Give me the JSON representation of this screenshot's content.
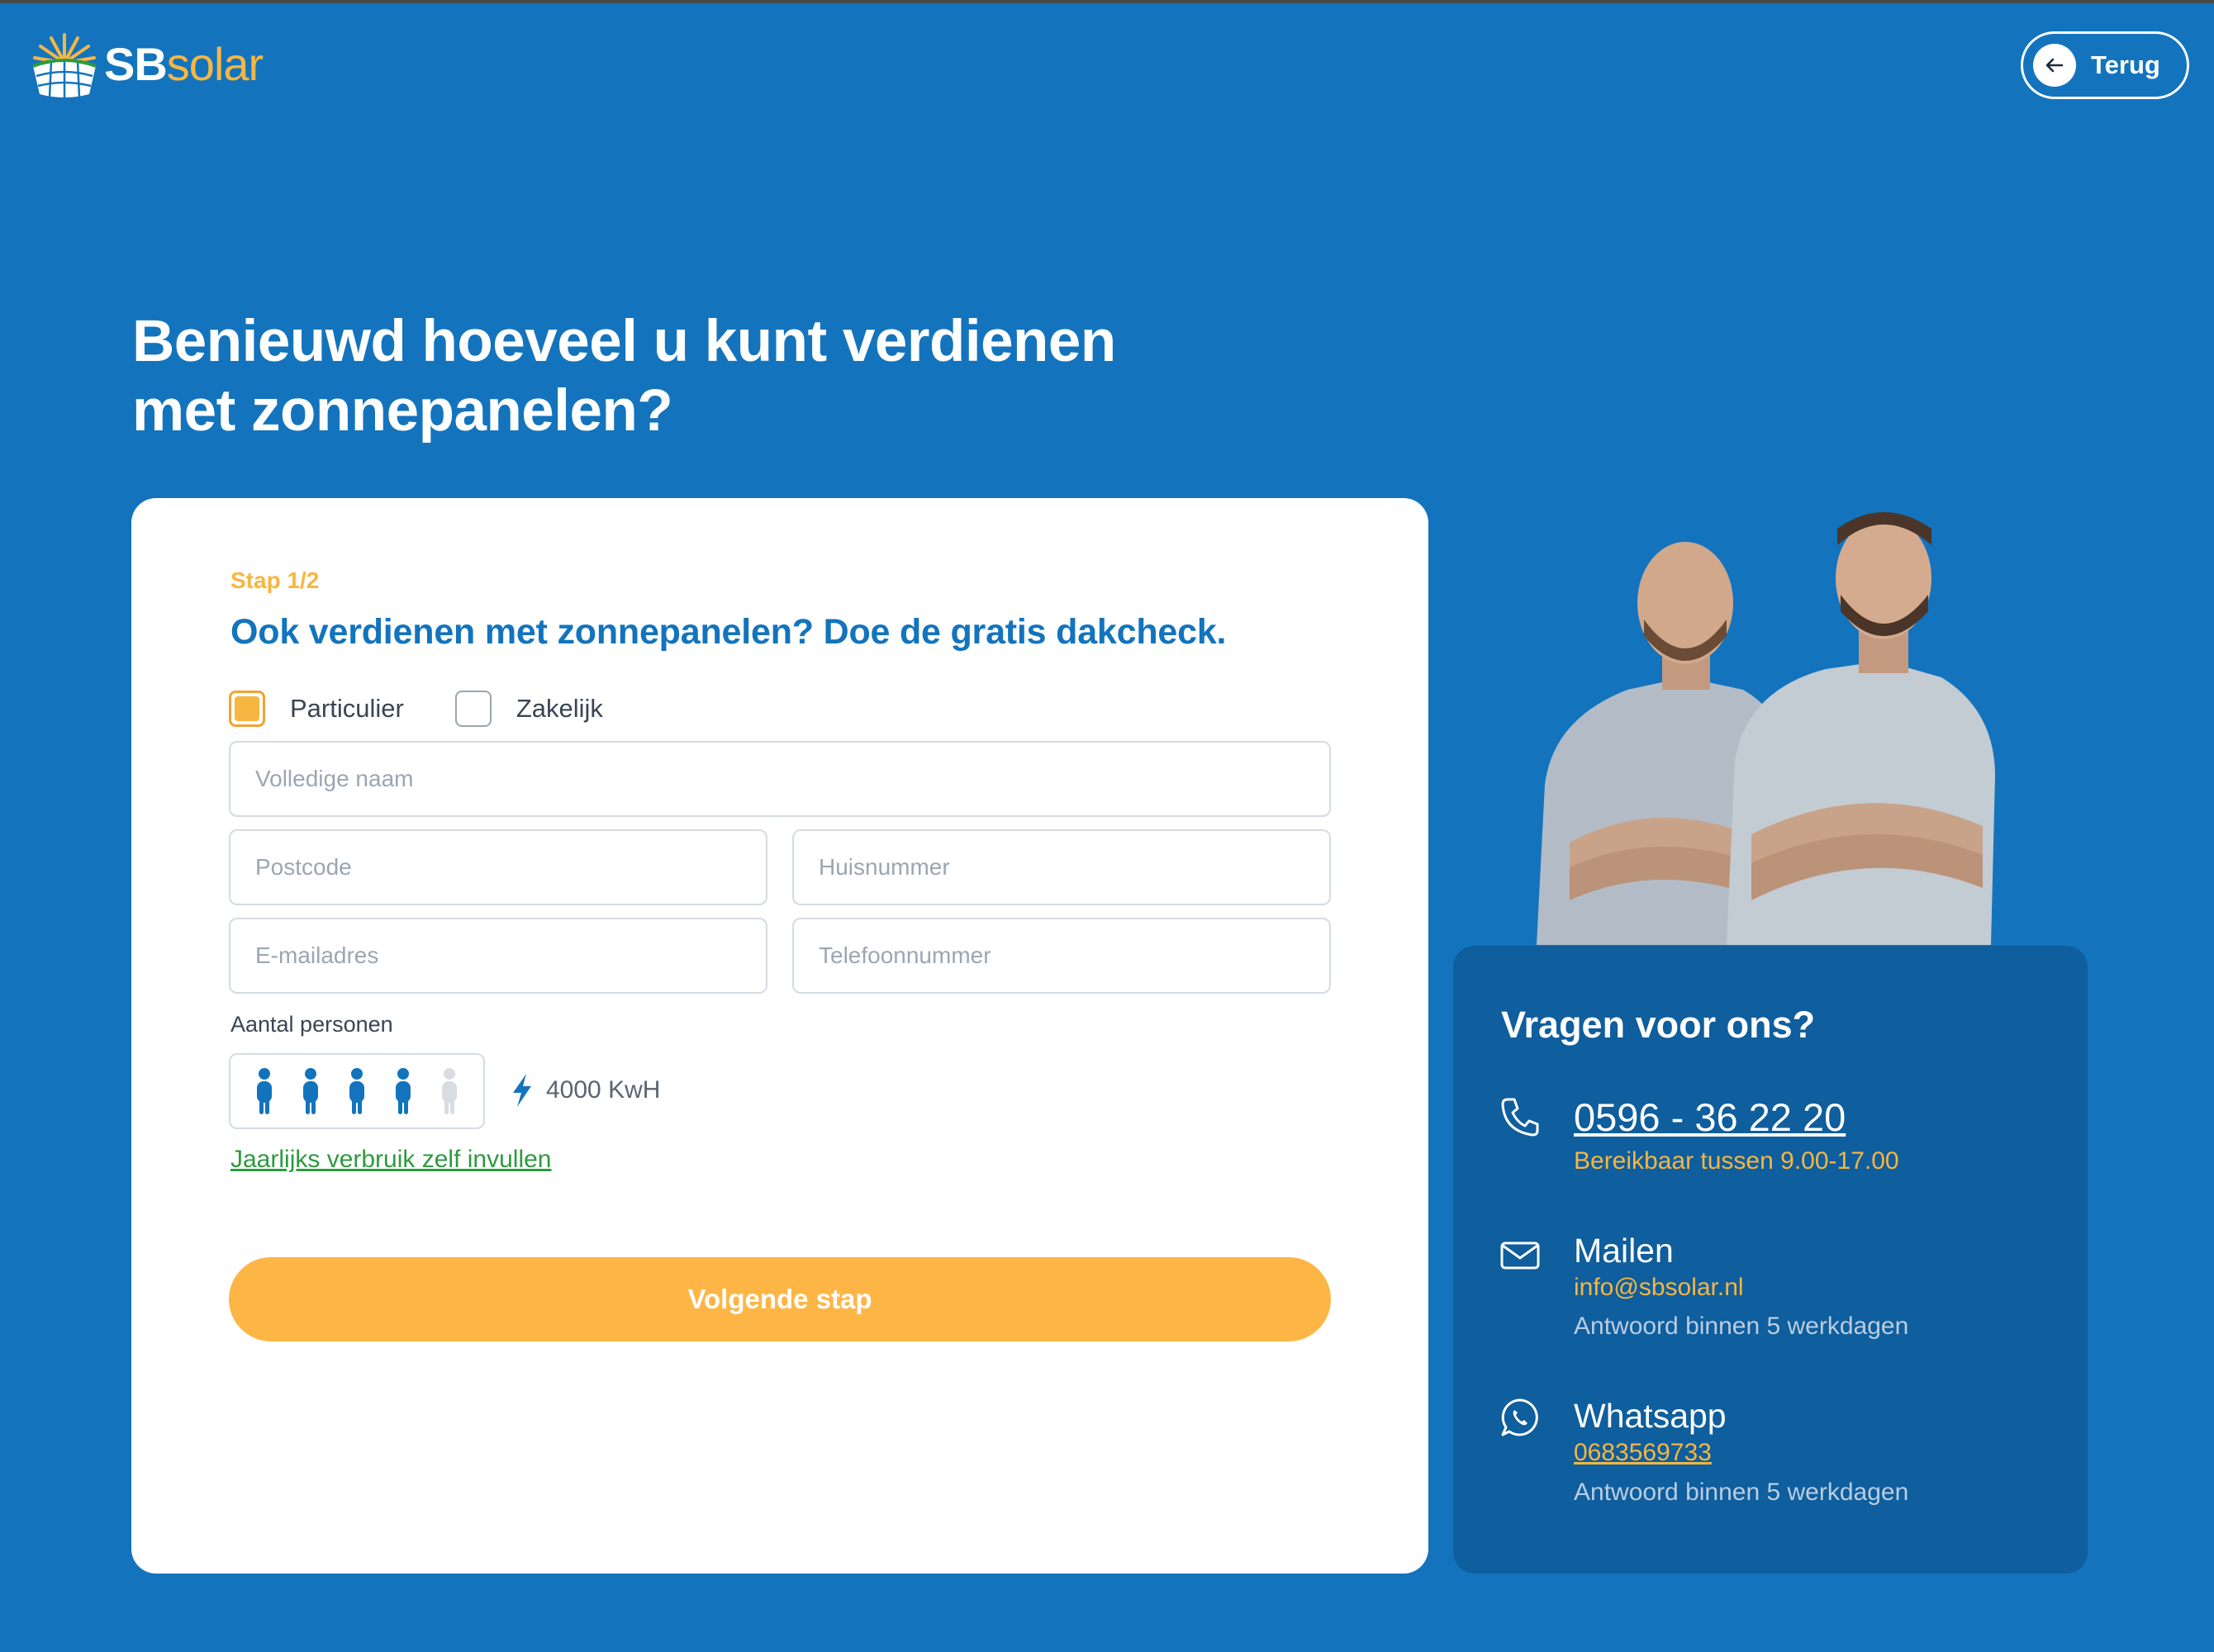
{
  "header": {
    "brand_bold": "SB",
    "brand_light": "solar",
    "back_label": "Terug"
  },
  "headline": {
    "line1": "Benieuwd hoeveel u kunt verdienen",
    "line2": "met zonnepanelen?"
  },
  "form": {
    "step": "Stap 1/2",
    "title": "Ook verdienen met zonnepanelen? Doe de gratis dakcheck.",
    "options": [
      {
        "label": "Particulier",
        "checked": true
      },
      {
        "label": "Zakelijk",
        "checked": false
      }
    ],
    "fields": {
      "name_placeholder": "Volledige naam",
      "postcode_placeholder": "Postcode",
      "huisnummer_placeholder": "Huisnummer",
      "email_placeholder": "E-mailadres",
      "telefoon_placeholder": "Telefoonnummer"
    },
    "persons_label": "Aantal personen",
    "persons_selected": 4,
    "persons_max": 5,
    "usage": "4000 KwH",
    "custom_usage_link": "Jaarlijks verbruik zelf invullen",
    "next_button": "Volgende stap"
  },
  "contact": {
    "title": "Vragen voor ons?",
    "phone": {
      "number": "0596 - 36 22 20",
      "hours": "Bereikbaar tussen 9.00-17.00"
    },
    "mail": {
      "label": "Mailen",
      "address": "info@sbsolar.nl",
      "response": "Antwoord binnen 5 werkdagen"
    },
    "whatsapp": {
      "label": "Whatsapp",
      "number": "0683569733",
      "response": "Antwoord binnen 5 werkdagen"
    }
  },
  "colors": {
    "background": "#1374bd",
    "accent": "#fdb646",
    "panel": "#0f5e9d",
    "link_green": "#2e9a3e"
  }
}
